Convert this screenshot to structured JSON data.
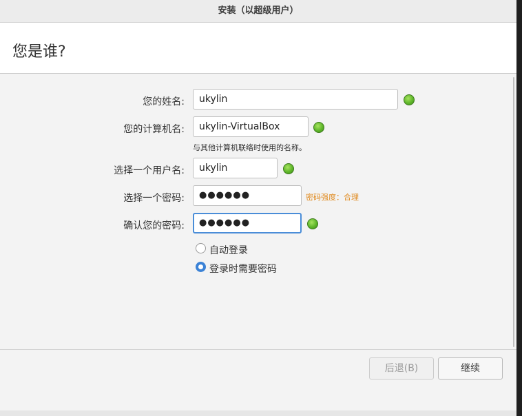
{
  "window": {
    "title": "安装（以超级用户）"
  },
  "page": {
    "heading": "您是谁?"
  },
  "form": {
    "name_label": "您的姓名:",
    "name_value": "ukylin",
    "computer_label": "您的计算机名:",
    "computer_value": "ukylin-VirtualBox",
    "computer_hint": "与其他计算机联络时使用的名称。",
    "username_label": "选择一个用户名:",
    "username_value": "ukylin",
    "password_label": "选择一个密码:",
    "password_value": "●●●●●●",
    "password_strength": "密码强度：合理",
    "confirm_label": "确认您的密码:",
    "confirm_value": "●●●●●●",
    "auto_login_label": "自动登录",
    "require_password_label": "登录时需要密码"
  },
  "footer": {
    "back_label": "后退(B)",
    "continue_label": "继续"
  },
  "colors": {
    "accent": "#4a8dd8",
    "ok_green": "#5fb62a",
    "strength_orange": "#e08a1e"
  },
  "icons": {
    "valid": "green-check-dot-icon"
  }
}
